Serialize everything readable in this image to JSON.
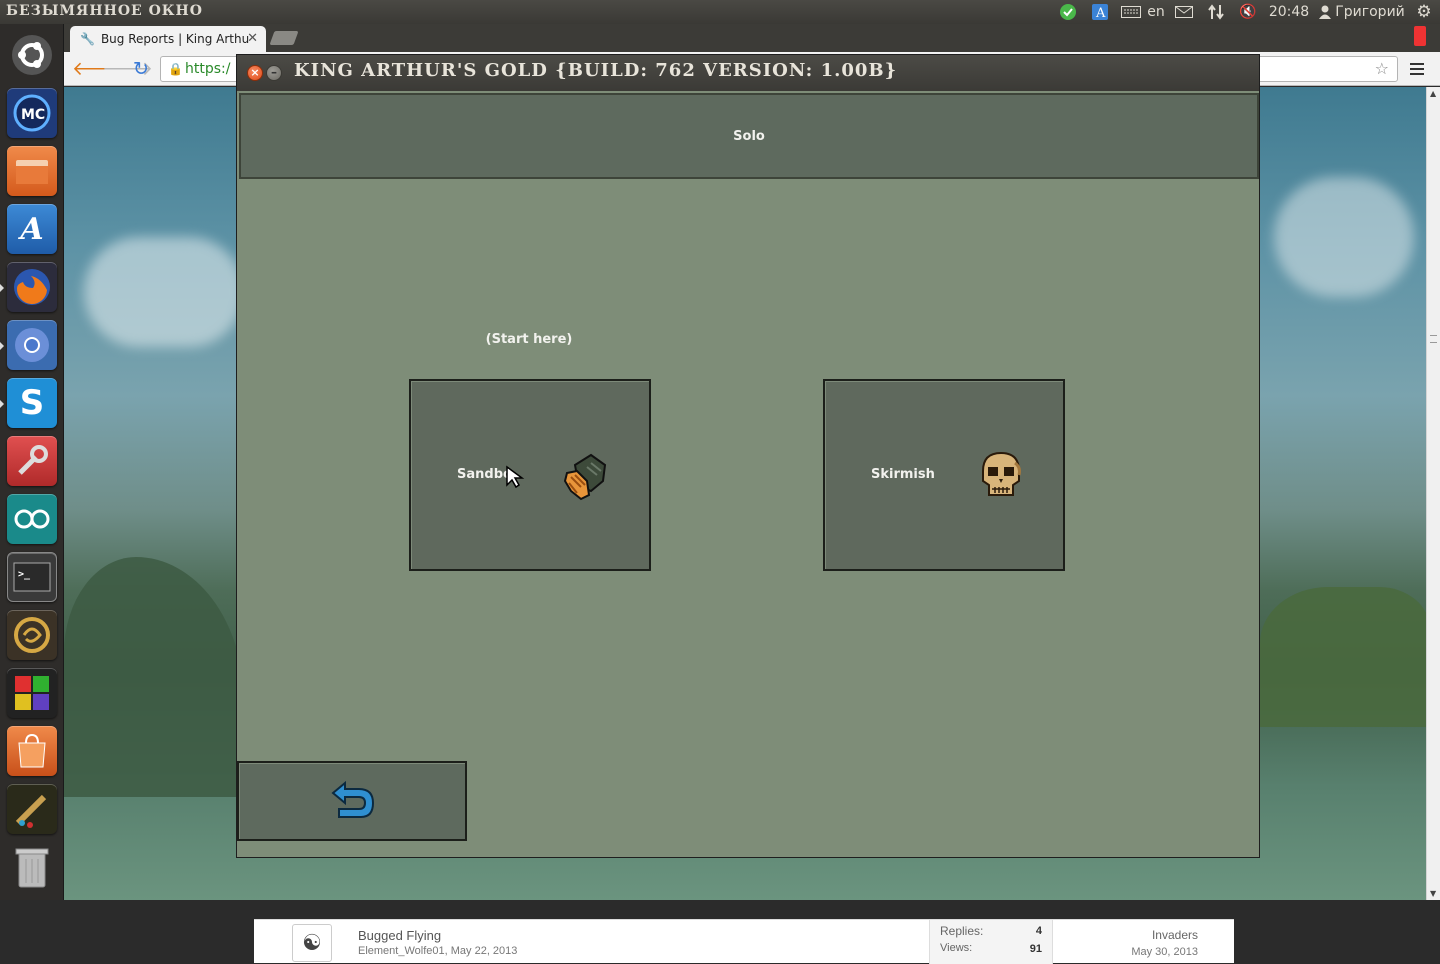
{
  "system_panel": {
    "window_title": "БЕЗЫМЯННОЕ ОКНО",
    "keyboard_layout": "en",
    "clock": "20:48",
    "user_name": "Григорий"
  },
  "browser": {
    "tab_title": "Bug Reports | King Arthu",
    "url_fragment": "https:/"
  },
  "forum_row": {
    "thread_title": "Bugged Flying",
    "author": "Element_Wolfe01",
    "date": "May 22, 2013",
    "replies_label": "Replies:",
    "replies_value": "4",
    "views_label": "Views:",
    "views_value": "91",
    "last_poster": "Invaders",
    "last_date": "May 30, 2013"
  },
  "game": {
    "window_title": "KING ARTHUR'S GOLD {BUILD: 762 VERSION: 1.00B}",
    "header": "Solo",
    "hint": "(Start here)",
    "sandbox_label": "Sandbo",
    "skirmish_label": "Skirmish"
  },
  "colors": {
    "game_background": "#7e8d78",
    "button_fill": "#5f695d",
    "back_arrow": "#2f8fd0"
  },
  "icons": [
    "ubuntu-dash-icon",
    "mc-icon",
    "files-icon",
    "text-editor-icon",
    "firefox-icon",
    "chromium-icon",
    "skype-icon",
    "system-settings-icon",
    "arduino-icon",
    "terminal-icon",
    "kag-dragon-icon",
    "colorful-cube-icon",
    "software-center-icon",
    "brush-icon",
    "trash-icon",
    "gauntlet-icon",
    "skull-icon",
    "back-arrow-icon"
  ]
}
